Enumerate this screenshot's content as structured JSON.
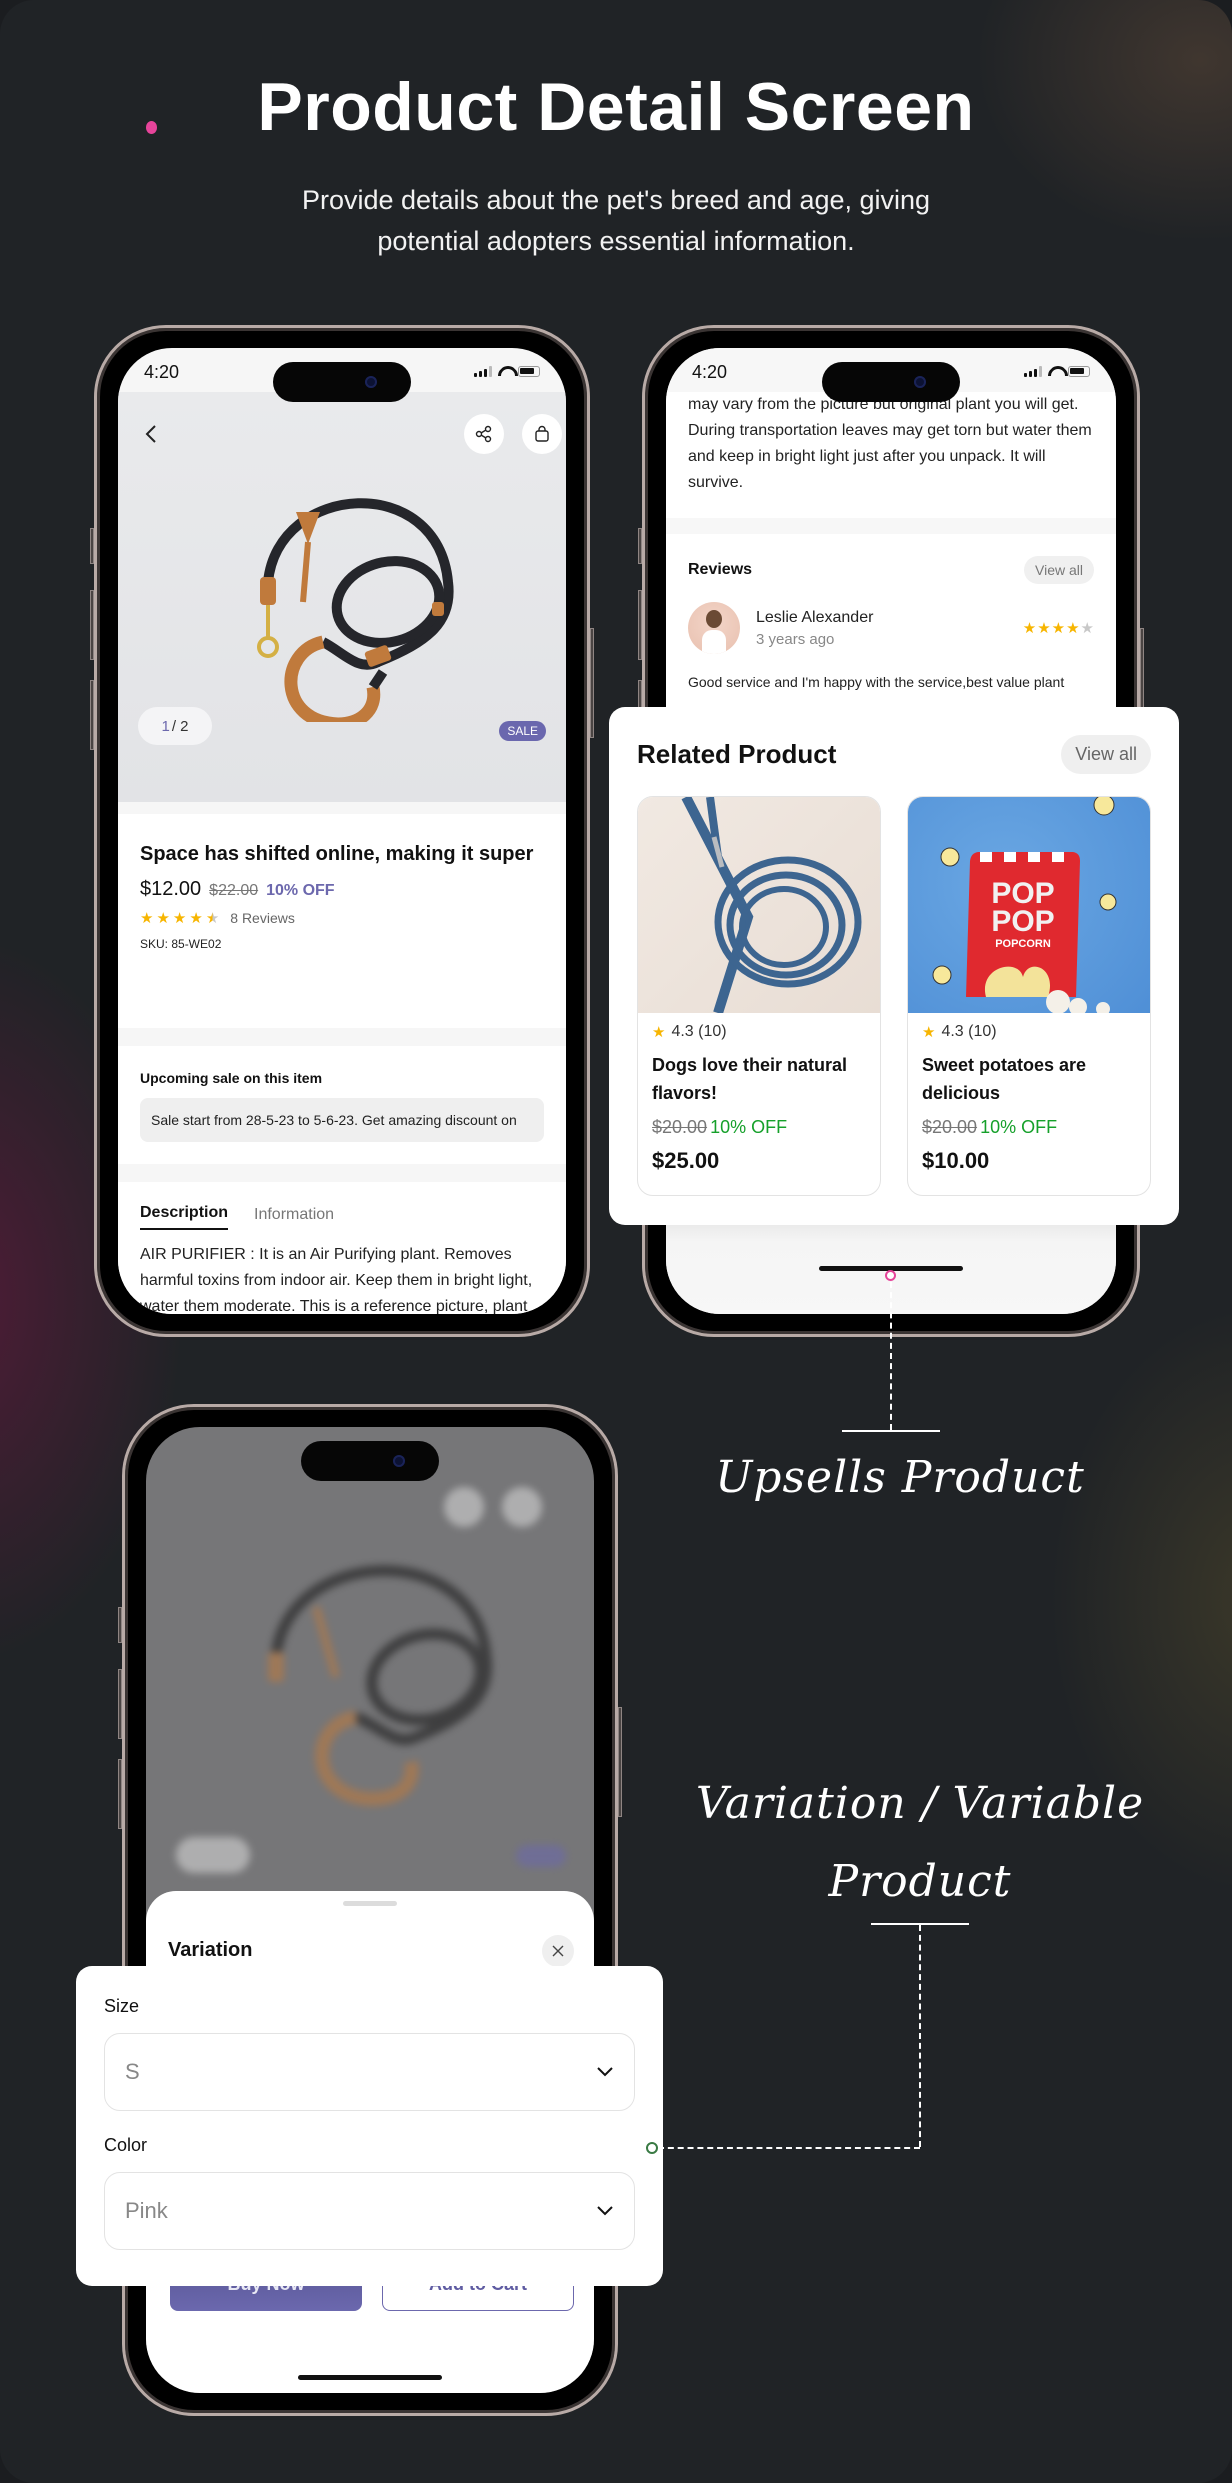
{
  "header": {
    "title": "Product Detail Screen",
    "subtitle": "Provide details about the pet's breed and age, giving potential adopters essential information."
  },
  "colors": {
    "accent": "#6a67ae",
    "pink_marker": "#e6449a",
    "green_marker": "#3a7a44",
    "discount_green": "#15a02a",
    "star": "#f7b500",
    "background": "#202326"
  },
  "phone1": {
    "status_time": "4:20",
    "pager_current": "1",
    "pager_total": "/ 2",
    "sale_badge": "SALE",
    "product_title": "Space has shifted online, making it super",
    "price_now": "$12.00",
    "price_old": "$22.00",
    "discount": "10% OFF",
    "rating": 4.5,
    "reviews_label": "8 Reviews",
    "sku": "SKU: 85-WE02",
    "upcoming_sale_heading": "Upcoming sale on this item",
    "upcoming_sale_text": "Sale start from 28-5-23 to 5-6-23. Get amazing discount on",
    "tabs": [
      {
        "label": "Description",
        "active": true
      },
      {
        "label": "Information",
        "active": false
      }
    ],
    "description": "AIR PURIFIER : It is an Air Purifying plant. Removes harmful toxins from indoor air. Keep them in bright light, water them moderate. This is a reference picture, plant"
  },
  "phone2": {
    "status_time": "4:20",
    "description_cont": "may vary from the picture but original plant you will get. During transportation leaves may get torn but water them and keep in bright light just after you unpack. It will survive.",
    "reviews_heading": "Reviews",
    "view_all": "View all",
    "review": {
      "name": "Leslie Alexander",
      "time": "3 years ago",
      "rating": 4,
      "text": "Good service and I'm happy with the service,best value plant"
    }
  },
  "related": {
    "title": "Related Product",
    "view_all": "View all",
    "items": [
      {
        "rating": "4.3 (10)",
        "name": "Dogs love their natural flavors!",
        "price_old": "$20.00",
        "discount": "10% OFF",
        "price_now": "$25.00",
        "image": "blue-leash"
      },
      {
        "rating": "4.3 (10)",
        "name": "Sweet potatoes are delicious",
        "price_old": "$20.00",
        "discount": "10% OFF",
        "price_now": "$10.00",
        "image": "popcorn-bag"
      }
    ],
    "popcorn_text": {
      "line1": "POP",
      "line2": "POP",
      "line3": "POPCORN"
    }
  },
  "annotations": {
    "upsells": "Upsells Product",
    "variation_line1": "Variation / Variable",
    "variation_line2": "Product"
  },
  "phone3": {
    "sheet_title": "Variation",
    "size_label": "Size",
    "size_value": "S",
    "color_label": "Color",
    "color_value": "Pink",
    "buy_now": "Buy Now",
    "add_to_cart": "Add to Cart"
  }
}
